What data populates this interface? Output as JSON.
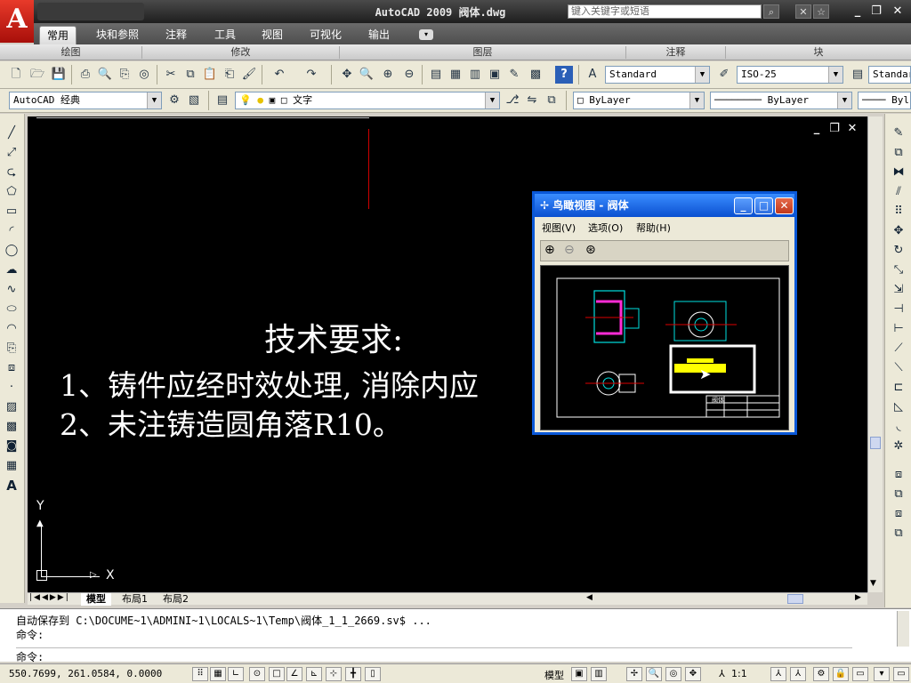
{
  "app": {
    "logo_letter": "A",
    "window_title": "AutoCAD 2009 阀体.dwg",
    "search_placeholder": "键入关键字或短语",
    "minimize": "_",
    "restore": "❐",
    "close": "✕"
  },
  "ribbon": {
    "tabs": [
      "常用",
      "块和参照",
      "注释",
      "工具",
      "视图",
      "可视化",
      "输出"
    ],
    "panels": [
      "绘图",
      "修改",
      "图层",
      "注释",
      "块"
    ]
  },
  "toolbar": {
    "text_style": "Standard",
    "dim_style": "ISO-25",
    "table_style": "Standar",
    "workspace": "AutoCAD 经典",
    "layer": "文字",
    "color": "ByLayer",
    "linetype": "ByLayer",
    "lineweight": "Byl"
  },
  "drawing": {
    "heading": "技术要求:",
    "line1": "1、铸件应经时效处理, 消除内应",
    "line2": "2、未注铸造圆角落R10。",
    "axis_y": "Y",
    "axis_x": "X",
    "canvas_min": "_",
    "canvas_restore": "❐",
    "canvas_close": "✕"
  },
  "layout_tabs": [
    "模型",
    "布局1",
    "布局2"
  ],
  "aerial": {
    "title": "鸟瞰视图 - 阀体",
    "menus": [
      "视图(V)",
      "选项(O)",
      "帮助(H)"
    ],
    "title_block": "阀体"
  },
  "command": {
    "line1": "自动保存到 C:\\DOCUME~1\\ADMINI~1\\LOCALS~1\\Temp\\阀体_1_1_2669.sv$ ...",
    "line2": "命令:",
    "line3": "命令:"
  },
  "status": {
    "coords": "550.7699, 261.0584, 0.0000",
    "model": "模型",
    "scale": "1:1"
  },
  "colors": {
    "canvas_bg": "#000000",
    "selection": "#ffffff",
    "highlight": "#ffff00"
  }
}
